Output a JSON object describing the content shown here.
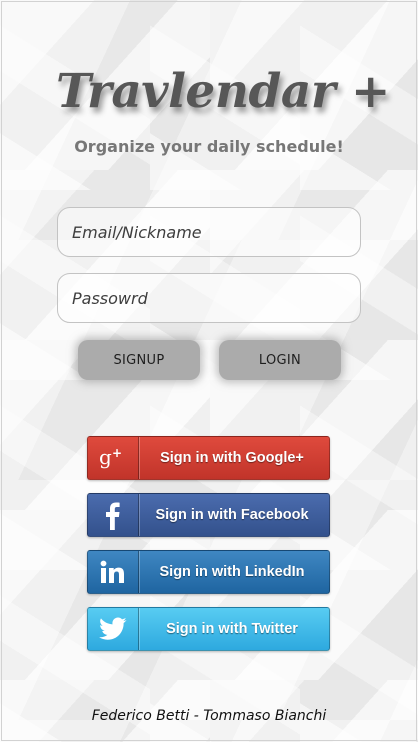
{
  "app": {
    "title": "Travlendar +",
    "subtitle": "Organize your daily schedule!"
  },
  "form": {
    "email_placeholder": "Email/Nickname",
    "password_placeholder": "Passowrd",
    "email_value": "",
    "password_value": ""
  },
  "buttons": {
    "signup": "SIGNUP",
    "login": "LOGIN"
  },
  "social": [
    {
      "label": "Sign in with Google+",
      "icon": "google-plus-icon",
      "color": "#d23f34"
    },
    {
      "label": "Sign in with Facebook",
      "icon": "facebook-icon",
      "color": "#3b5998"
    },
    {
      "label": "Sign in with LinkedIn",
      "icon": "linkedin-icon",
      "color": "#2b77b5"
    },
    {
      "label": "Sign in with Twitter",
      "icon": "twitter-icon",
      "color": "#3fb8e8"
    }
  ],
  "footer": {
    "credits": "Federico Betti - Tommaso Bianchi"
  }
}
